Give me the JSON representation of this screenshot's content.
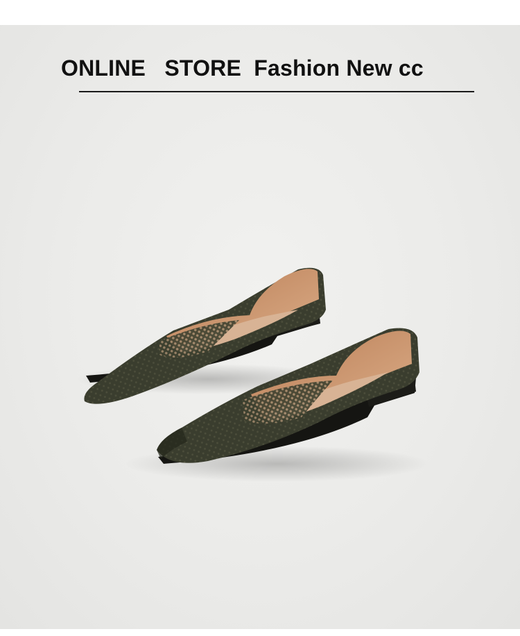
{
  "header": {
    "title": "ONLINE   STORE  Fashion New cc"
  },
  "product": {
    "image_subject": "pair of dark olive green knit pointed-toe flat shoes",
    "colors": {
      "knit": "#3a3d2e",
      "knit_dark": "#2b2e22",
      "lining": "#c9936b",
      "insole": "#d8b395",
      "sole": "#151512",
      "background": "#ebebe9"
    }
  }
}
